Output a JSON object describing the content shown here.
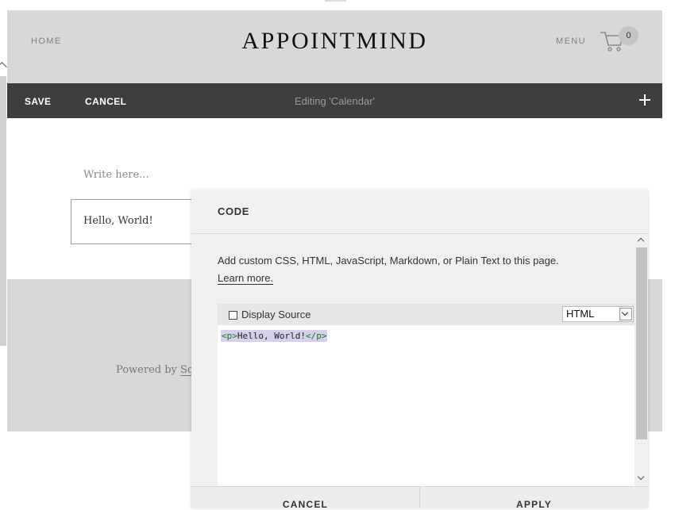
{
  "site": {
    "nav_home": "HOME",
    "title": "APPOINTMIND",
    "nav_menu": "MENU",
    "cart_count": "0",
    "icons": {
      "cart": "cart-icon"
    }
  },
  "edit_bar": {
    "save_label": "SAVE",
    "cancel_label": "CANCEL",
    "editing_label": "Editing 'Calendar'",
    "add_icon": "plus-icon"
  },
  "content": {
    "placeholder": "Write here...",
    "block_text": "Hello, World!"
  },
  "footer": {
    "powered_by": "Powered by ",
    "link_text": "Sq"
  },
  "code_dialog": {
    "title": "CODE",
    "description": "Add custom CSS, HTML, JavaScript, Markdown, or Plain Text to this page.",
    "learn_more": "Learn more.",
    "display_source_label": "Display Source",
    "display_source_checked": false,
    "language": "HTML",
    "code": {
      "open_tag": "<p>",
      "text": "Hello, World!",
      "close_tag": "</p>"
    },
    "cancel_label": "CANCEL",
    "apply_label": "APPLY",
    "highlight_color": "#d6d0ee",
    "tag_color": "#137a13"
  }
}
